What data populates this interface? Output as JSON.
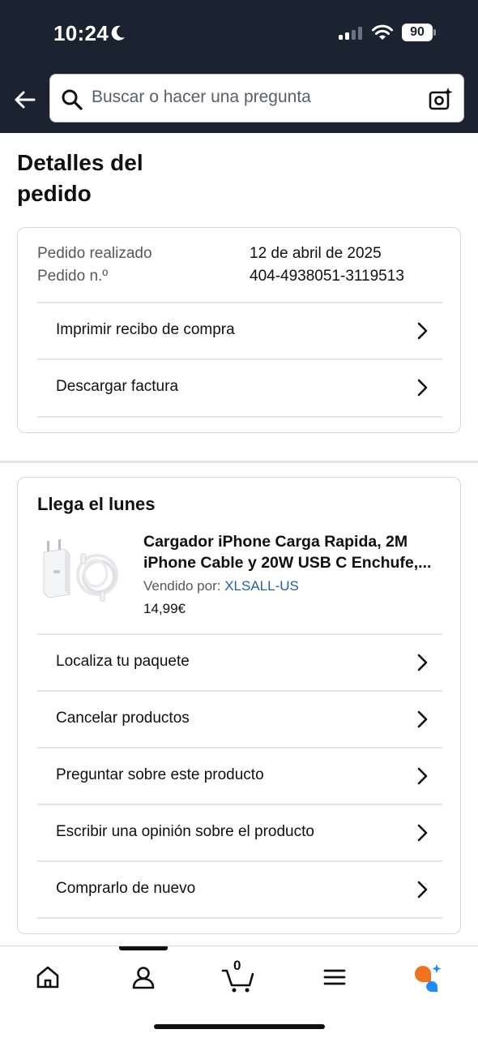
{
  "status_bar": {
    "time": "10:24",
    "battery": "90"
  },
  "search": {
    "placeholder": "Buscar o hacer una pregunta"
  },
  "page": {
    "title": "Detalles del pedido"
  },
  "order_info": {
    "placed_label": "Pedido realizado",
    "placed_value": "12 de abril de 2025",
    "number_label": "Pedido n.º",
    "number_value": "404-4938051-3119513",
    "actions": [
      "Imprimir recibo de compra",
      "Descargar factura"
    ]
  },
  "delivery": {
    "title": "Llega el lunes",
    "product": {
      "title_line1": "Cargador iPhone Carga Rapida, 2M",
      "title_line2": "iPhone Cable y 20W USB C Enchufe,...",
      "seller_prefix": "Vendido por:",
      "seller_name": "XLSALL-US",
      "price": "14,99€"
    },
    "actions": [
      "Localiza tu paquete",
      "Cancelar productos",
      "Preguntar sobre este producto",
      "Escribir una opinión sobre el producto",
      "Comprarlo de nuevo"
    ]
  },
  "bottom_nav": {
    "items": [
      "home-icon",
      "account-icon",
      "cart-icon",
      "menu-icon",
      "rufus-icon"
    ],
    "cart_count": "0"
  },
  "colors": {
    "header_bg": "#1c2330",
    "link": "#2162a1",
    "rufus_orange": "#f0721e",
    "rufus_blue": "#1a8cff"
  }
}
